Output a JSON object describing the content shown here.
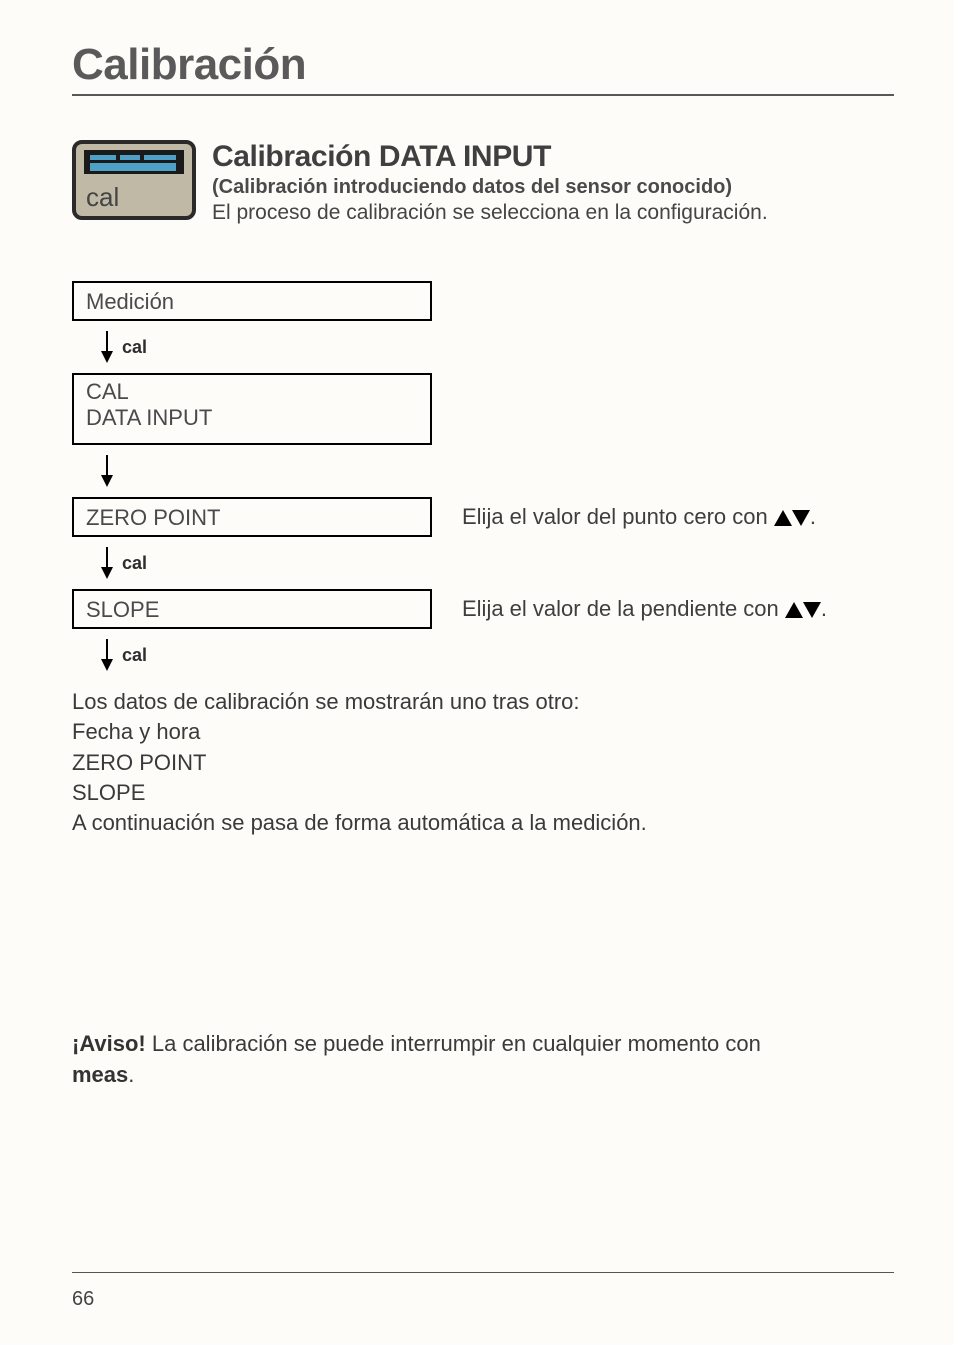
{
  "page": {
    "title": "Calibración",
    "number": "66"
  },
  "intro": {
    "heading": "Calibración DATA INPUT",
    "subheading": "(Calibración introduciendo datos del sensor conocido)",
    "description": "El proceso de calibración se selecciona en la configuración.",
    "icon_label": "cal"
  },
  "flow": {
    "step_medicion": "Medición",
    "arrow_cal": "cal",
    "step_cal_line1": "CAL",
    "step_cal_line2": "DATA INPUT",
    "step_zero": "ZERO POINT",
    "side_zero_pre": "Elija el valor del punto cero con ",
    "side_zero_post": ".",
    "step_slope": "SLOPE",
    "side_slope_pre": "Elija el valor de la pendiente con ",
    "side_slope_post": "."
  },
  "results": {
    "line1": "Los datos de calibración se mostrarán uno tras otro:",
    "line2": "Fecha y hora",
    "line3": "ZERO POINT",
    "line4": "SLOPE",
    "line5": "A continuación se pasa de forma automática a la medición."
  },
  "notice": {
    "label": "¡Aviso!",
    "text_part1": " La calibración se puede interrumpir en cualquier momento con ",
    "meas": "meas",
    "text_part2": "."
  }
}
